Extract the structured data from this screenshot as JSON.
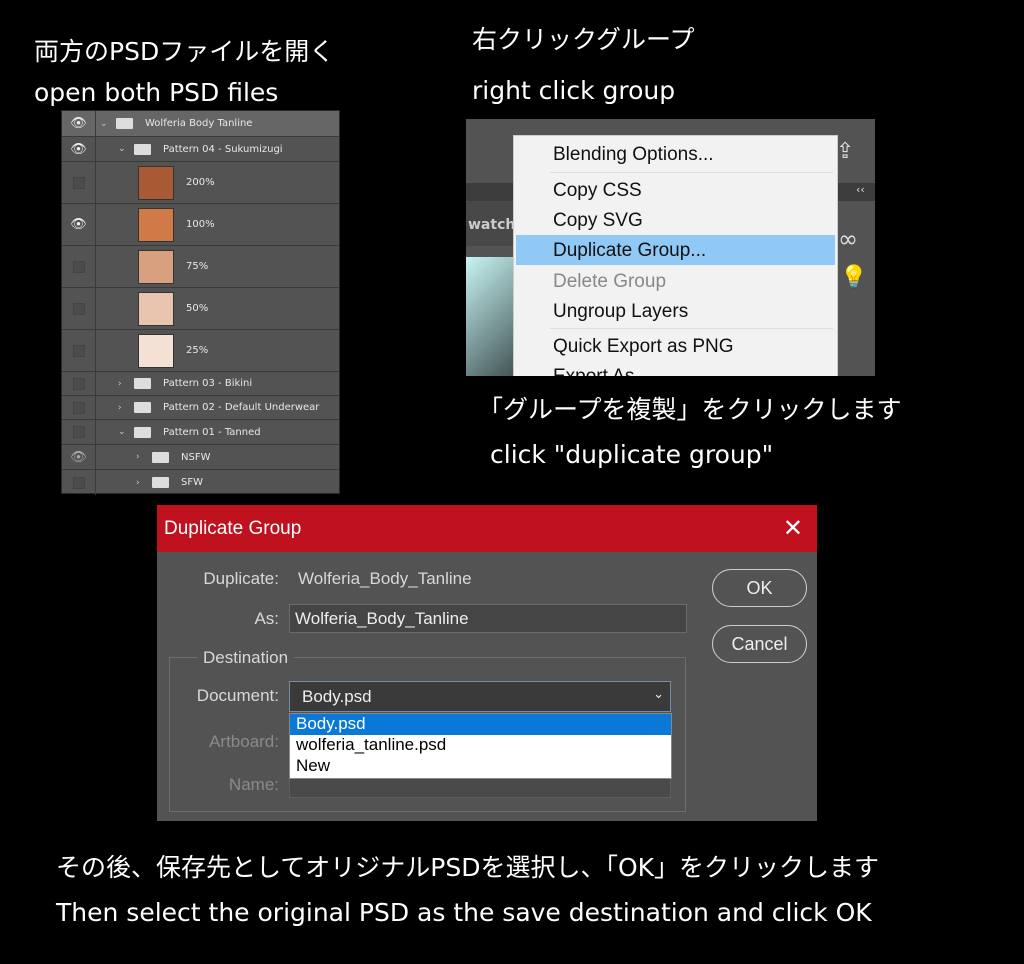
{
  "captions": {
    "step1_ja": "両方のPSDファイルを開く",
    "step1_en": "open both PSD files",
    "step2_ja": "右クリックグループ",
    "step2_en": "right click group",
    "step3_ja": "「グループを複製」をクリックします",
    "step3_en": "click \"duplicate group\"",
    "step4_ja": "その後、保存先としてオリジナルPSDを選択し、「OK」をクリックします",
    "step4_en": "Then select the original PSD as the save destination and click OK"
  },
  "layers": {
    "root": "Wolferia  Body  Tanline",
    "group4": "Pattern 04 - Sukumizugi",
    "sub": [
      "200%",
      "100%",
      "75%",
      "50%",
      "25%"
    ],
    "group3": "Pattern 03 - Bikini",
    "group2": "Pattern 02 - Default Underwear",
    "group1": "Pattern 01 - Tanned",
    "nsfw": "NSFW",
    "sfw": "SFW"
  },
  "menu": {
    "bg_tab": "watche",
    "items": [
      "Blending Options...",
      "Copy CSS",
      "Copy SVG",
      "Duplicate Group...",
      "Delete Group",
      "Ungroup Layers",
      "Quick Export as PNG",
      "Export As..."
    ]
  },
  "dialog": {
    "title": "Duplicate Group",
    "duplicate_label": "Duplicate:",
    "duplicate_value": "Wolferia_Body_Tanline",
    "as_label": "As:",
    "as_value": "Wolferia_Body_Tanline",
    "destination": "Destination",
    "document_label": "Document:",
    "document_value": "Body.psd",
    "artboard_label": "Artboard:",
    "name_label": "Name:",
    "options": [
      "Body.psd",
      "wolferia_tanline.psd",
      "New"
    ],
    "ok": "OK",
    "cancel": "Cancel",
    "accent": "#c0111f"
  }
}
